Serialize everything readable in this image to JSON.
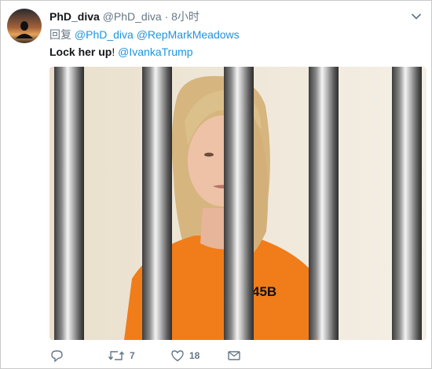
{
  "tweet": {
    "display_name": "PhD_diva",
    "handle": "@PhD_diva",
    "separator": "·",
    "time": "8小时",
    "reply_prefix": "回复",
    "reply_to": [
      "@PhD_diva",
      "@RepMarkMeadows"
    ],
    "text_main": "Lock her up",
    "text_punct": "!",
    "text_mention": "@IvankaTrump",
    "media": {
      "number_on_shirt": "45B",
      "colors": {
        "uniform": "#f07d1a",
        "wall": "#efe6d6",
        "hair": "#d9bb86",
        "bars": "#9a9a9a"
      }
    }
  },
  "actions": {
    "reply_count": "",
    "retweet_count": "7",
    "like_count": "18",
    "dm_count": ""
  },
  "colors": {
    "link": "#1b95e0",
    "muted": "#657786",
    "text": "#14171a"
  },
  "icons": [
    "avatar",
    "chevron-down-icon",
    "reply-icon",
    "retweet-icon",
    "like-icon",
    "direct-message-icon"
  ]
}
